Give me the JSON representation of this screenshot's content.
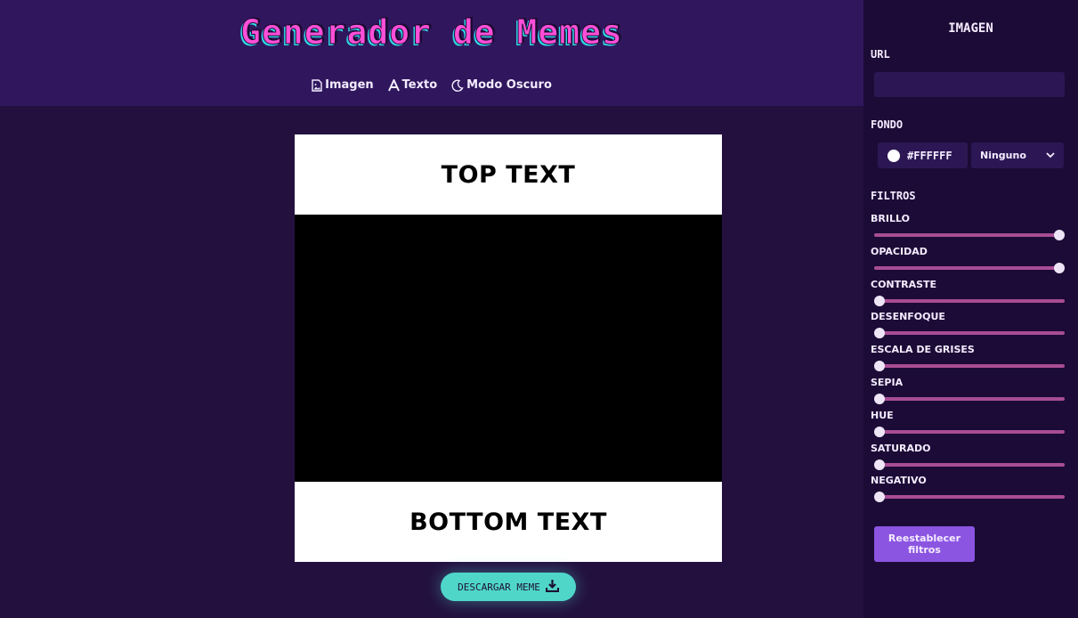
{
  "header": {
    "title": "Generador de Memes",
    "nav": [
      {
        "label": "Imagen",
        "icon": "image-file-icon"
      },
      {
        "label": "Texto",
        "icon": "text-a-icon"
      },
      {
        "label": "Modo Oscuro",
        "icon": "moon-icon"
      }
    ]
  },
  "meme": {
    "top_text": "TOP TEXT",
    "bottom_text": "BOTTOM TEXT",
    "background_color": "#FFFFFF"
  },
  "download": {
    "label": "DESCARGAR MEME",
    "icon": "download-icon"
  },
  "sidebar": {
    "title": "IMAGEN",
    "url_label": "URL",
    "url_value": "",
    "fondo_label": "FONDO",
    "color_value": "#FFFFFF",
    "blend_value": "Ninguno",
    "filtros_label": "FILTROS",
    "filters": [
      {
        "label": "BRILLO",
        "value": 1.0
      },
      {
        "label": "OPACIDAD",
        "value": 1.0
      },
      {
        "label": "CONTRASTE",
        "value": 0.0
      },
      {
        "label": "DESENFOQUE",
        "value": 0.0
      },
      {
        "label": "ESCALA DE GRISES",
        "value": 0.0
      },
      {
        "label": "SEPIA",
        "value": 0.0
      },
      {
        "label": "HUE",
        "value": 0.0
      },
      {
        "label": "SATURADO",
        "value": 0.0
      },
      {
        "label": "NEGATIVO",
        "value": 0.0
      }
    ],
    "reset_label": "Reestablecer filtros"
  },
  "colors": {
    "accent_pink": "#ff4fd8",
    "accent_cyan": "#2fd6e6",
    "download_bg": "#4fd6c9",
    "slider_track": "#a84d95",
    "reset_bg": "#8b55e2"
  }
}
